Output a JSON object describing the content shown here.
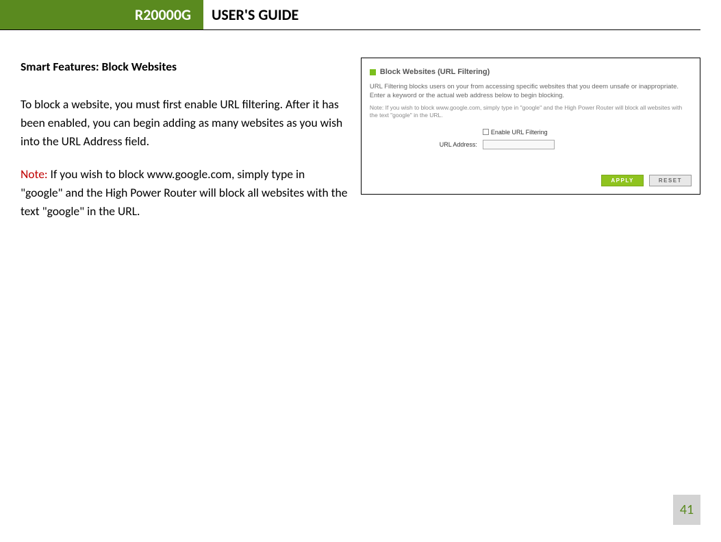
{
  "header": {
    "model": "R20000G",
    "title": "USER'S GUIDE"
  },
  "section": {
    "title": "Smart Features: Block Websites",
    "para1": "To block a website, you must first enable URL filtering. After it has been enabled, you can begin adding as many websites as you wish into the URL Address field.",
    "note_label": "Note:",
    "para2": "  If you wish to block www.google.com, simply type in \"google\" and the High Power Router will block all websites with the text \"google\" in the URL."
  },
  "screenshot": {
    "title": "Block Websites (URL Filtering)",
    "description": "URL Filtering blocks users on your from accessing specific websites that you deem unsafe or inappropriate. Enter a keyword or the actual web address below to begin blocking.",
    "note": "Note: If you wish to block www.google.com, simply type in \"google\" and the High Power Router will block all websites with the text \"google\" in the URL.",
    "enable_label": "Enable URL Filtering",
    "url_label": "URL Address:",
    "apply_btn": "APPLY",
    "reset_btn": "RESET"
  },
  "page_number": "41"
}
